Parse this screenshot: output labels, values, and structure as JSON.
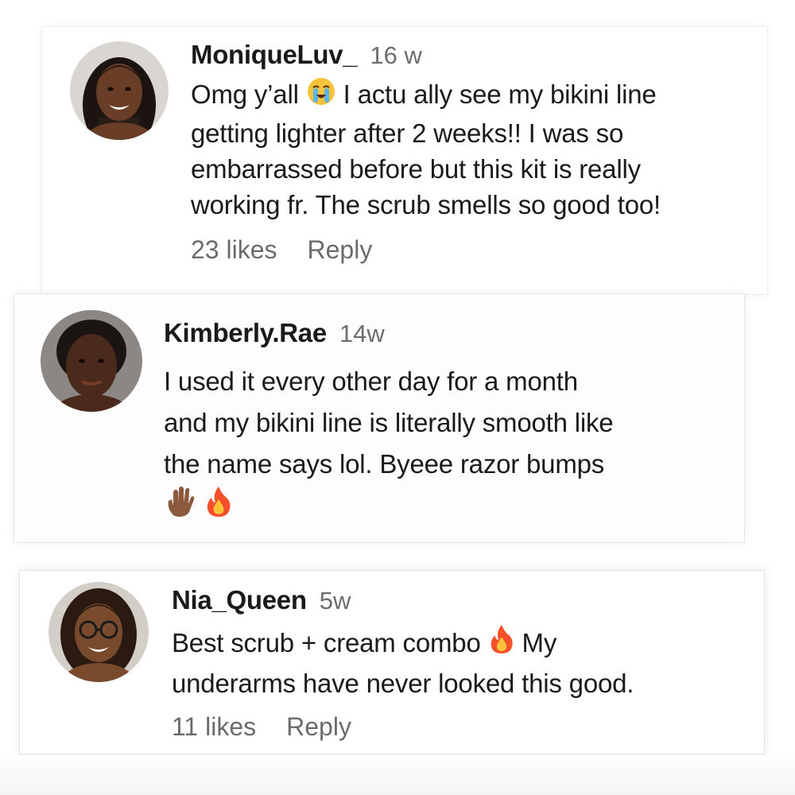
{
  "comments": [
    {
      "username": "MoniqueLuv_",
      "time": "16 w",
      "lines": [
        [
          "Omg y’all ",
          "loudly-crying-emoji",
          " I actu ally see my bikini line"
        ],
        [
          "getting lighter after 2 weeks!! I was so"
        ],
        [
          "embarrassed before but this kit is really"
        ],
        [
          "working fr. The scrub smells so good too!"
        ]
      ],
      "text_parts": {
        "l1a": "Omg y’all",
        "l1b": "I actu ally see my bikini line",
        "l2": "getting lighter after 2 weeks!! I was so",
        "l3": "embarrassed before but this kit is really",
        "l4": "working fr. The scrub smells so good too!"
      },
      "likes": "23 likes",
      "reply": "Reply"
    },
    {
      "username": "Kimberly.Rae",
      "time": "14w",
      "text_parts": {
        "l1": "I used it every other day for a month",
        "l2": "and my bikini line is literally smooth like",
        "l3": "the name says lol. Byeee razor bumps"
      },
      "emojis": [
        "waving-hand-emoji",
        "fire-emoji"
      ]
    },
    {
      "username": "Nia_Queen",
      "time": "5w",
      "text_parts": {
        "l1a": "Best scrub + cream combo",
        "l1b": "My",
        "l2": "underarms have never looked this good."
      },
      "likes": "11 likes",
      "reply": "Reply"
    }
  ],
  "colors": {
    "text": "#1a1a1a",
    "meta": "#6d6d6d",
    "background": "#ffffff"
  }
}
